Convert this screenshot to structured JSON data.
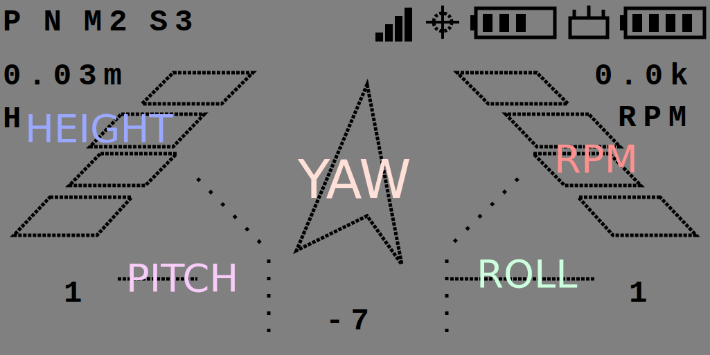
{
  "status_bar": {
    "flight_mode": "P",
    "gear": "N",
    "model": "M2",
    "switch": "S3",
    "signal_level": 1,
    "tx_battery_level": 0.75,
    "drone_battery_level": 1
  },
  "telemetry": {
    "height": "0.03m",
    "height_marker": "H",
    "distance": "0.0k",
    "rpm_marker": "RPM",
    "pitch_value": "1",
    "roll_value": "1",
    "yaw_value": "-7"
  },
  "labels": [
    {
      "text": "HEIGHT",
      "color": "#9aa8ff"
    },
    {
      "text": "YAW",
      "color": "#ffe0d8"
    },
    {
      "text": "RPM",
      "color": "#ff9090"
    },
    {
      "text": "PITCH",
      "color": "#f8ccf8"
    },
    {
      "text": "ROLL",
      "color": "#ccffdd"
    }
  ]
}
